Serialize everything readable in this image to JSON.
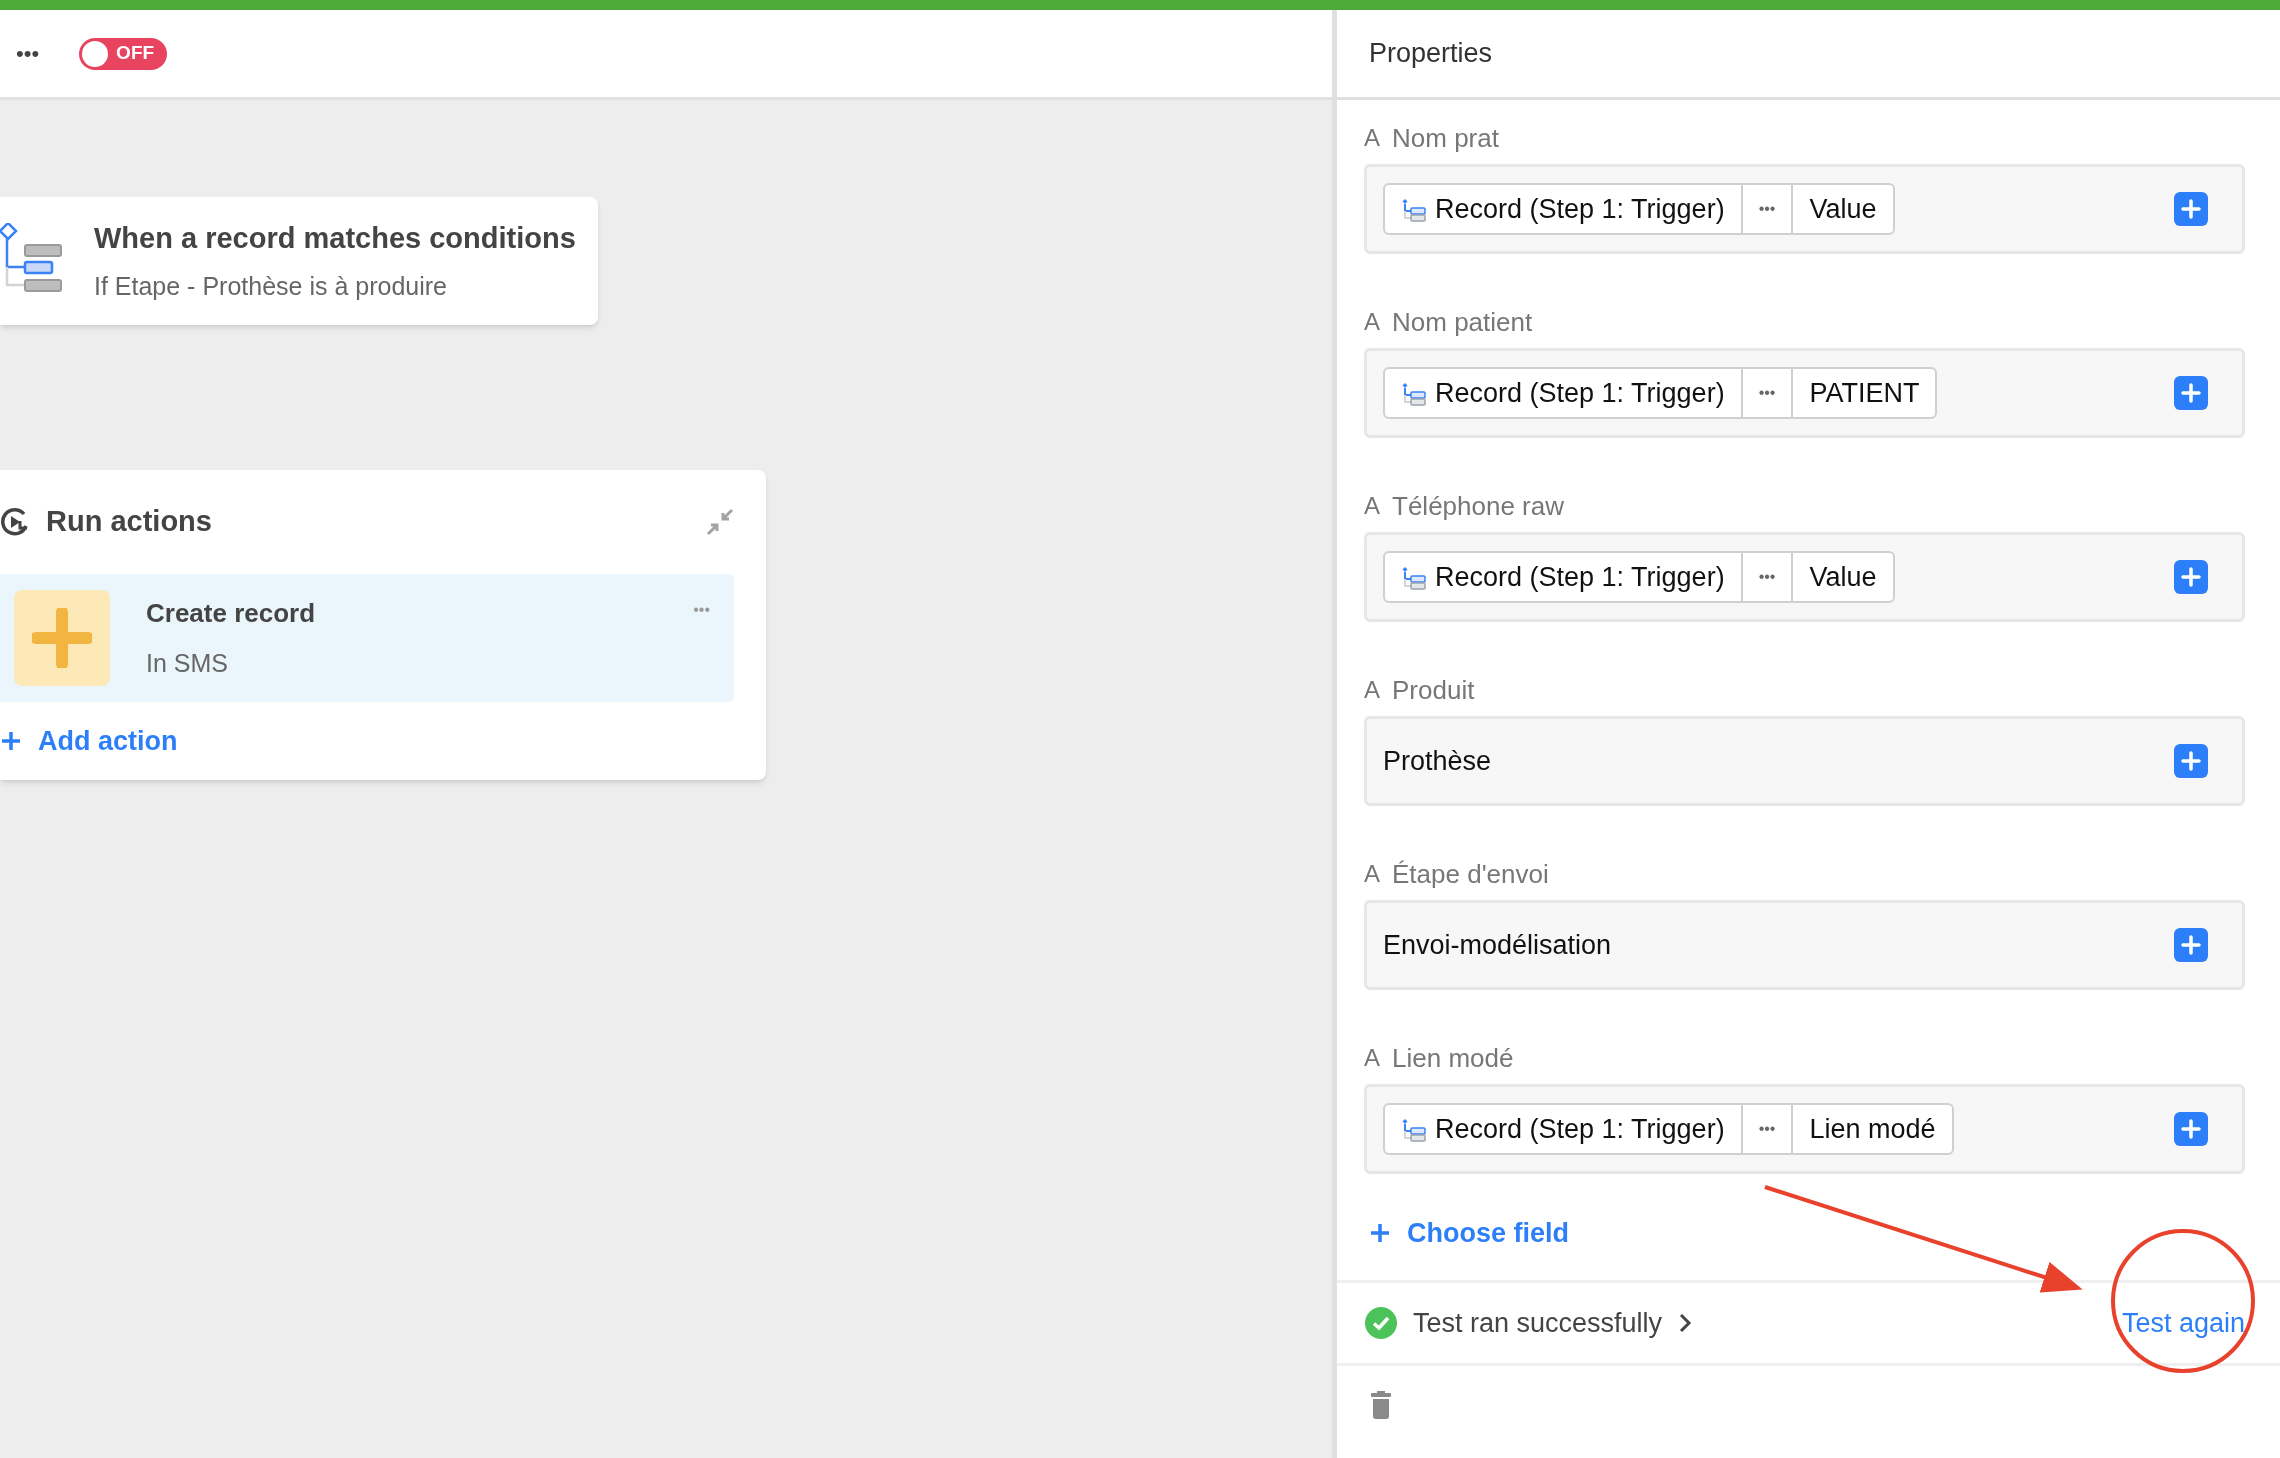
{
  "toolbar": {
    "more_label": "•••",
    "toggle": {
      "label": "OFF",
      "on": false
    }
  },
  "trigger": {
    "title": "When a record matches conditions",
    "subtitle": "If Etape - Prothèse is à produire"
  },
  "actions_panel": {
    "title": "Run actions",
    "actions": [
      {
        "title": "Create record",
        "subtitle": "In SMS",
        "more": "•••",
        "selected": true
      }
    ],
    "add_label": "Add action"
  },
  "properties": {
    "title": "Properties",
    "fields": [
      {
        "type_glyph": "A",
        "label": "Nom prat",
        "kind": "reference",
        "source": "Record (Step 1: Trigger)",
        "more": "•••",
        "value": "Value"
      },
      {
        "type_glyph": "A",
        "label": "Nom patient",
        "kind": "reference",
        "source": "Record (Step 1: Trigger)",
        "more": "•••",
        "value": "PATIENT"
      },
      {
        "type_glyph": "A",
        "label": "Téléphone raw",
        "kind": "reference",
        "source": "Record (Step 1: Trigger)",
        "more": "•••",
        "value": "Value"
      },
      {
        "type_glyph": "A",
        "label": "Produit",
        "kind": "text",
        "value": "Prothèse"
      },
      {
        "type_glyph": "A",
        "label": "Étape d'envoi",
        "kind": "text",
        "value": "Envoi-modélisation"
      },
      {
        "type_glyph": "A",
        "label": "Lien modé",
        "kind": "reference",
        "source": "Record (Step 1: Trigger)",
        "more": "•••",
        "value": "Lien modé"
      }
    ],
    "choose_field": "Choose field",
    "test": {
      "status": "Test ran successfully",
      "success": true,
      "again": "Test again"
    }
  }
}
